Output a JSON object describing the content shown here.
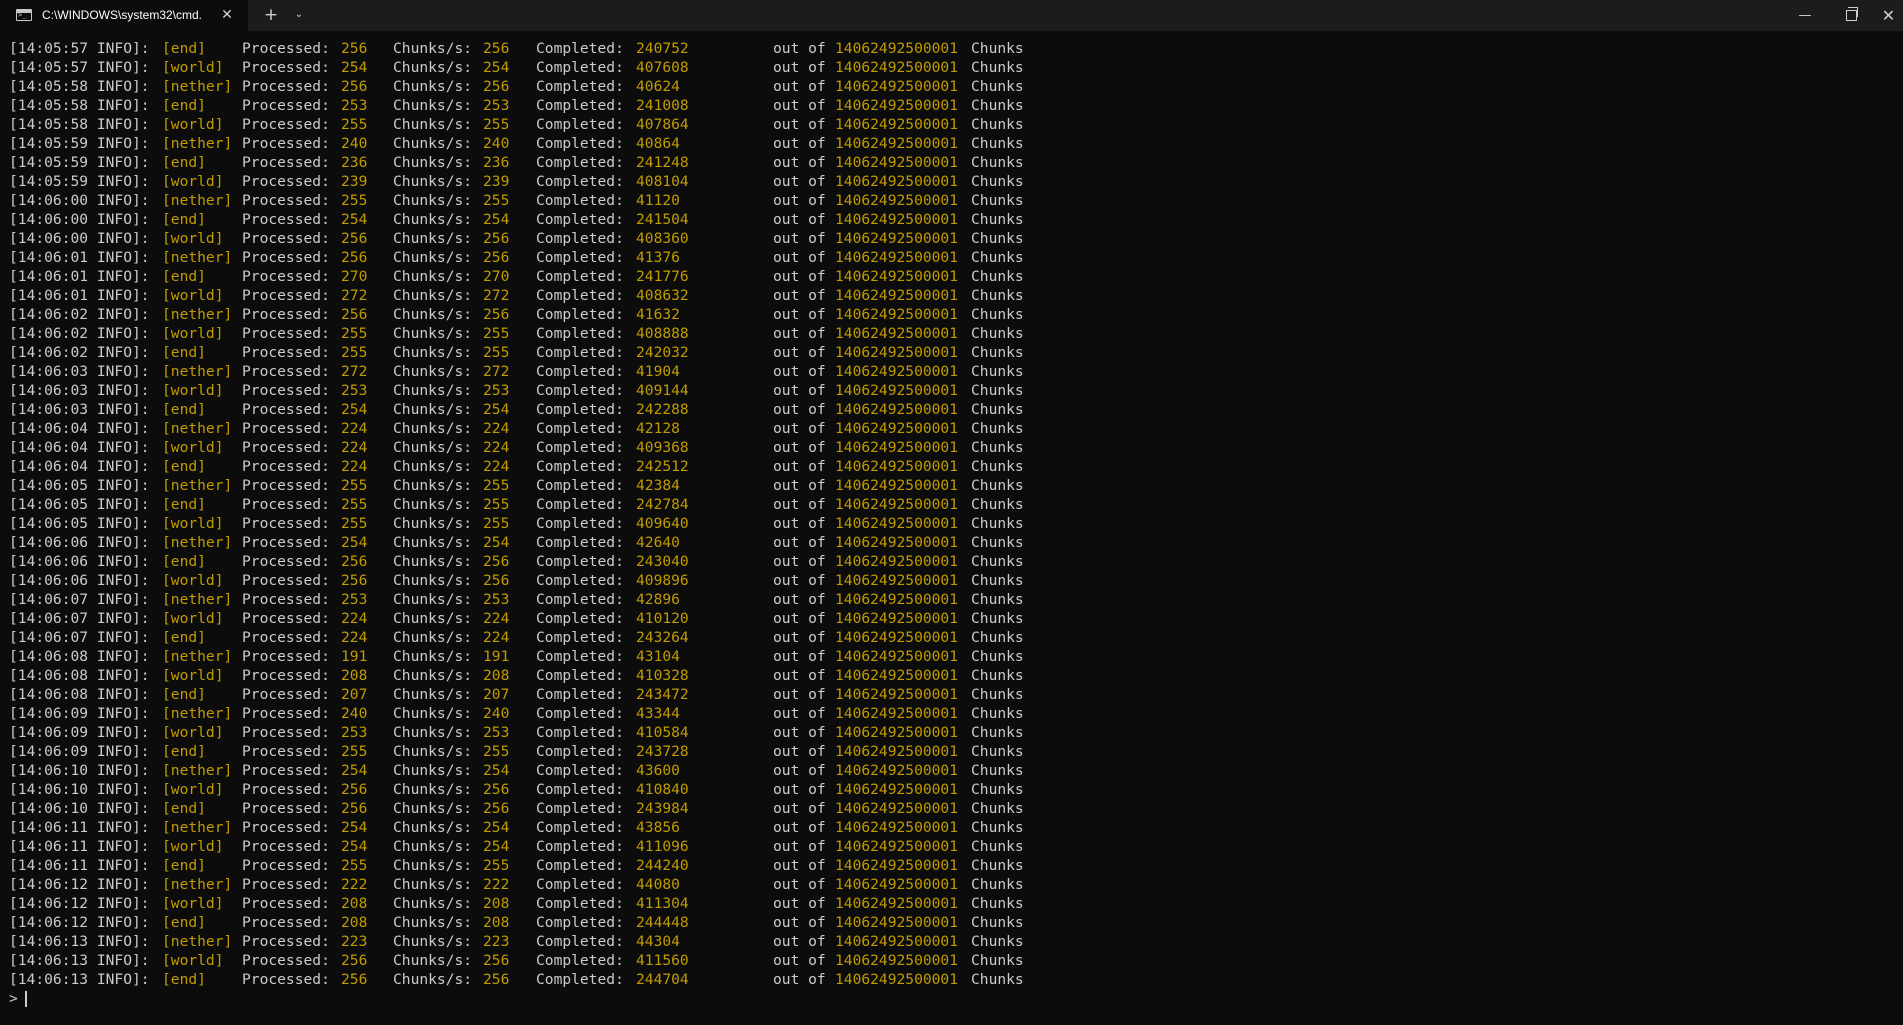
{
  "window": {
    "tab_title": "C:\\WINDOWS\\system32\\cmd.",
    "tab_close": "✕",
    "new_tab": "+",
    "dropdown": "⌄",
    "minimize": "—",
    "close": "✕"
  },
  "labels": {
    "processed": "Processed:",
    "chunks_per_sec": "Chunks/s:",
    "completed": "Completed:",
    "out_of": "out of",
    "chunks": "Chunks"
  },
  "prompt": ">",
  "log": [
    {
      "ts": "[14:05:57 INFO]:",
      "dim": "[end]",
      "proc": "256",
      "cps": "256",
      "comp": "240752",
      "total": "14062492500001"
    },
    {
      "ts": "[14:05:57 INFO]:",
      "dim": "[world]",
      "proc": "254",
      "cps": "254",
      "comp": "407608",
      "total": "14062492500001"
    },
    {
      "ts": "[14:05:58 INFO]:",
      "dim": "[nether]",
      "proc": "256",
      "cps": "256",
      "comp": "40624",
      "total": "14062492500001"
    },
    {
      "ts": "[14:05:58 INFO]:",
      "dim": "[end]",
      "proc": "253",
      "cps": "253",
      "comp": "241008",
      "total": "14062492500001"
    },
    {
      "ts": "[14:05:58 INFO]:",
      "dim": "[world]",
      "proc": "255",
      "cps": "255",
      "comp": "407864",
      "total": "14062492500001"
    },
    {
      "ts": "[14:05:59 INFO]:",
      "dim": "[nether]",
      "proc": "240",
      "cps": "240",
      "comp": "40864",
      "total": "14062492500001"
    },
    {
      "ts": "[14:05:59 INFO]:",
      "dim": "[end]",
      "proc": "236",
      "cps": "236",
      "comp": "241248",
      "total": "14062492500001"
    },
    {
      "ts": "[14:05:59 INFO]:",
      "dim": "[world]",
      "proc": "239",
      "cps": "239",
      "comp": "408104",
      "total": "14062492500001"
    },
    {
      "ts": "[14:06:00 INFO]:",
      "dim": "[nether]",
      "proc": "255",
      "cps": "255",
      "comp": "41120",
      "total": "14062492500001"
    },
    {
      "ts": "[14:06:00 INFO]:",
      "dim": "[end]",
      "proc": "254",
      "cps": "254",
      "comp": "241504",
      "total": "14062492500001"
    },
    {
      "ts": "[14:06:00 INFO]:",
      "dim": "[world]",
      "proc": "256",
      "cps": "256",
      "comp": "408360",
      "total": "14062492500001"
    },
    {
      "ts": "[14:06:01 INFO]:",
      "dim": "[nether]",
      "proc": "256",
      "cps": "256",
      "comp": "41376",
      "total": "14062492500001"
    },
    {
      "ts": "[14:06:01 INFO]:",
      "dim": "[end]",
      "proc": "270",
      "cps": "270",
      "comp": "241776",
      "total": "14062492500001"
    },
    {
      "ts": "[14:06:01 INFO]:",
      "dim": "[world]",
      "proc": "272",
      "cps": "272",
      "comp": "408632",
      "total": "14062492500001"
    },
    {
      "ts": "[14:06:02 INFO]:",
      "dim": "[nether]",
      "proc": "256",
      "cps": "256",
      "comp": "41632",
      "total": "14062492500001"
    },
    {
      "ts": "[14:06:02 INFO]:",
      "dim": "[world]",
      "proc": "255",
      "cps": "255",
      "comp": "408888",
      "total": "14062492500001"
    },
    {
      "ts": "[14:06:02 INFO]:",
      "dim": "[end]",
      "proc": "255",
      "cps": "255",
      "comp": "242032",
      "total": "14062492500001"
    },
    {
      "ts": "[14:06:03 INFO]:",
      "dim": "[nether]",
      "proc": "272",
      "cps": "272",
      "comp": "41904",
      "total": "14062492500001"
    },
    {
      "ts": "[14:06:03 INFO]:",
      "dim": "[world]",
      "proc": "253",
      "cps": "253",
      "comp": "409144",
      "total": "14062492500001"
    },
    {
      "ts": "[14:06:03 INFO]:",
      "dim": "[end]",
      "proc": "254",
      "cps": "254",
      "comp": "242288",
      "total": "14062492500001"
    },
    {
      "ts": "[14:06:04 INFO]:",
      "dim": "[nether]",
      "proc": "224",
      "cps": "224",
      "comp": "42128",
      "total": "14062492500001"
    },
    {
      "ts": "[14:06:04 INFO]:",
      "dim": "[world]",
      "proc": "224",
      "cps": "224",
      "comp": "409368",
      "total": "14062492500001"
    },
    {
      "ts": "[14:06:04 INFO]:",
      "dim": "[end]",
      "proc": "224",
      "cps": "224",
      "comp": "242512",
      "total": "14062492500001"
    },
    {
      "ts": "[14:06:05 INFO]:",
      "dim": "[nether]",
      "proc": "255",
      "cps": "255",
      "comp": "42384",
      "total": "14062492500001"
    },
    {
      "ts": "[14:06:05 INFO]:",
      "dim": "[end]",
      "proc": "255",
      "cps": "255",
      "comp": "242784",
      "total": "14062492500001"
    },
    {
      "ts": "[14:06:05 INFO]:",
      "dim": "[world]",
      "proc": "255",
      "cps": "255",
      "comp": "409640",
      "total": "14062492500001"
    },
    {
      "ts": "[14:06:06 INFO]:",
      "dim": "[nether]",
      "proc": "254",
      "cps": "254",
      "comp": "42640",
      "total": "14062492500001"
    },
    {
      "ts": "[14:06:06 INFO]:",
      "dim": "[end]",
      "proc": "256",
      "cps": "256",
      "comp": "243040",
      "total": "14062492500001"
    },
    {
      "ts": "[14:06:06 INFO]:",
      "dim": "[world]",
      "proc": "256",
      "cps": "256",
      "comp": "409896",
      "total": "14062492500001"
    },
    {
      "ts": "[14:06:07 INFO]:",
      "dim": "[nether]",
      "proc": "253",
      "cps": "253",
      "comp": "42896",
      "total": "14062492500001"
    },
    {
      "ts": "[14:06:07 INFO]:",
      "dim": "[world]",
      "proc": "224",
      "cps": "224",
      "comp": "410120",
      "total": "14062492500001"
    },
    {
      "ts": "[14:06:07 INFO]:",
      "dim": "[end]",
      "proc": "224",
      "cps": "224",
      "comp": "243264",
      "total": "14062492500001"
    },
    {
      "ts": "[14:06:08 INFO]:",
      "dim": "[nether]",
      "proc": "191",
      "cps": "191",
      "comp": "43104",
      "total": "14062492500001"
    },
    {
      "ts": "[14:06:08 INFO]:",
      "dim": "[world]",
      "proc": "208",
      "cps": "208",
      "comp": "410328",
      "total": "14062492500001"
    },
    {
      "ts": "[14:06:08 INFO]:",
      "dim": "[end]",
      "proc": "207",
      "cps": "207",
      "comp": "243472",
      "total": "14062492500001"
    },
    {
      "ts": "[14:06:09 INFO]:",
      "dim": "[nether]",
      "proc": "240",
      "cps": "240",
      "comp": "43344",
      "total": "14062492500001"
    },
    {
      "ts": "[14:06:09 INFO]:",
      "dim": "[world]",
      "proc": "253",
      "cps": "253",
      "comp": "410584",
      "total": "14062492500001"
    },
    {
      "ts": "[14:06:09 INFO]:",
      "dim": "[end]",
      "proc": "255",
      "cps": "255",
      "comp": "243728",
      "total": "14062492500001"
    },
    {
      "ts": "[14:06:10 INFO]:",
      "dim": "[nether]",
      "proc": "254",
      "cps": "254",
      "comp": "43600",
      "total": "14062492500001"
    },
    {
      "ts": "[14:06:10 INFO]:",
      "dim": "[world]",
      "proc": "256",
      "cps": "256",
      "comp": "410840",
      "total": "14062492500001"
    },
    {
      "ts": "[14:06:10 INFO]:",
      "dim": "[end]",
      "proc": "256",
      "cps": "256",
      "comp": "243984",
      "total": "14062492500001"
    },
    {
      "ts": "[14:06:11 INFO]:",
      "dim": "[nether]",
      "proc": "254",
      "cps": "254",
      "comp": "43856",
      "total": "14062492500001"
    },
    {
      "ts": "[14:06:11 INFO]:",
      "dim": "[world]",
      "proc": "254",
      "cps": "254",
      "comp": "411096",
      "total": "14062492500001"
    },
    {
      "ts": "[14:06:11 INFO]:",
      "dim": "[end]",
      "proc": "255",
      "cps": "255",
      "comp": "244240",
      "total": "14062492500001"
    },
    {
      "ts": "[14:06:12 INFO]:",
      "dim": "[nether]",
      "proc": "222",
      "cps": "222",
      "comp": "44080",
      "total": "14062492500001"
    },
    {
      "ts": "[14:06:12 INFO]:",
      "dim": "[world]",
      "proc": "208",
      "cps": "208",
      "comp": "411304",
      "total": "14062492500001"
    },
    {
      "ts": "[14:06:12 INFO]:",
      "dim": "[end]",
      "proc": "208",
      "cps": "208",
      "comp": "244448",
      "total": "14062492500001"
    },
    {
      "ts": "[14:06:13 INFO]:",
      "dim": "[nether]",
      "proc": "223",
      "cps": "223",
      "comp": "44304",
      "total": "14062492500001"
    },
    {
      "ts": "[14:06:13 INFO]:",
      "dim": "[world]",
      "proc": "256",
      "cps": "256",
      "comp": "411560",
      "total": "14062492500001"
    },
    {
      "ts": "[14:06:13 INFO]:",
      "dim": "[end]",
      "proc": "256",
      "cps": "256",
      "comp": "244704",
      "total": "14062492500001"
    }
  ]
}
